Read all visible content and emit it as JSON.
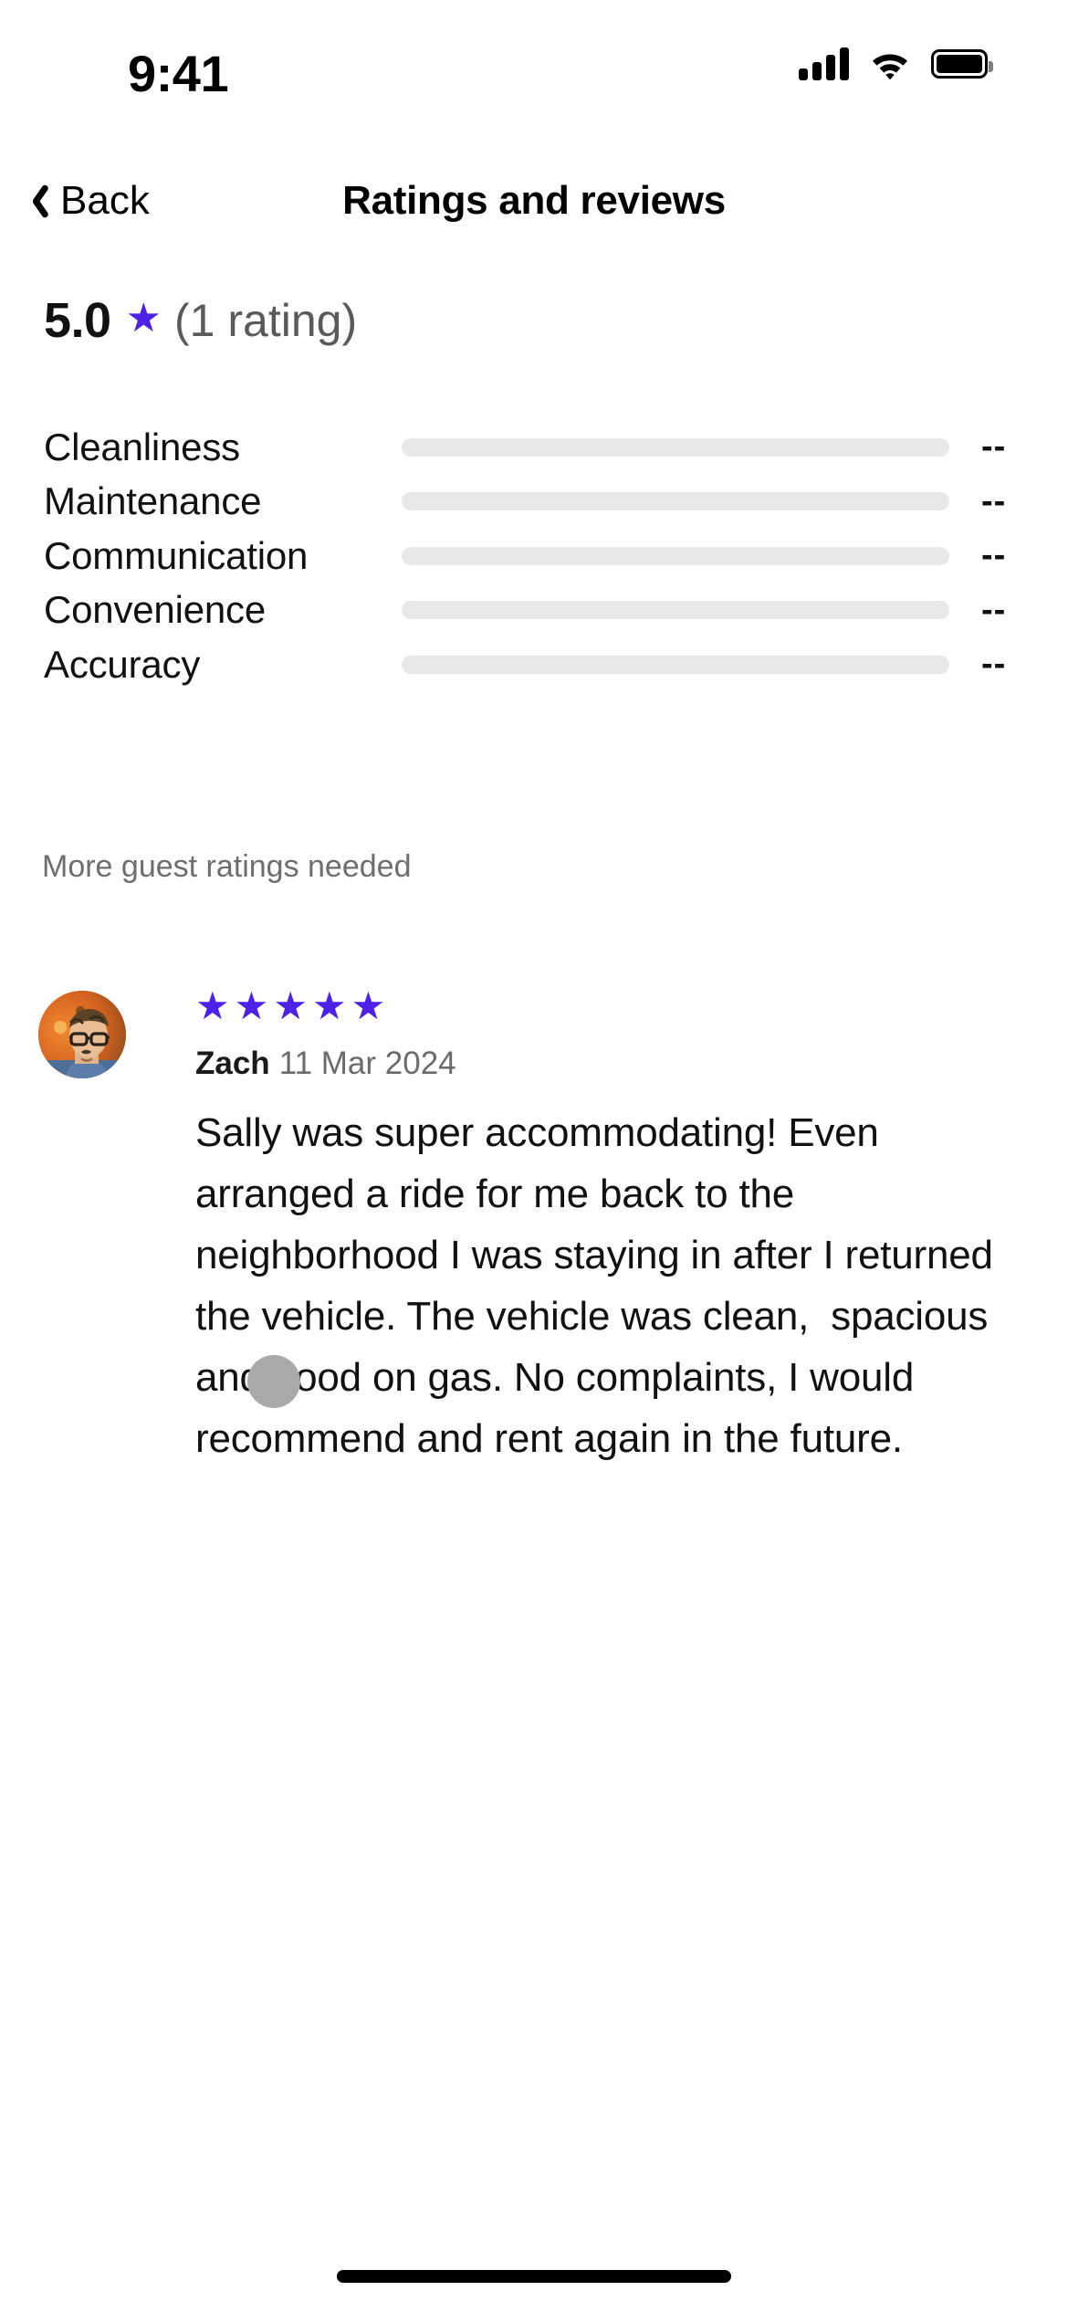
{
  "status_bar": {
    "time": "9:41",
    "cellular_icon": "cellular-signal-icon",
    "wifi_icon": "wifi-icon",
    "battery_icon": "battery-full-icon"
  },
  "nav": {
    "back_label": "Back",
    "back_icon": "chevron-left-icon",
    "title": "Ratings and reviews"
  },
  "overall": {
    "score": "5.0",
    "star_glyph": "★",
    "count_label": "(1 rating)"
  },
  "categories": [
    {
      "label": "Cleanliness",
      "value": "--",
      "bar_percent": 0
    },
    {
      "label": "Maintenance",
      "value": "--",
      "bar_percent": 0
    },
    {
      "label": "Communication",
      "value": "--",
      "bar_percent": 0
    },
    {
      "label": "Convenience",
      "value": "--",
      "bar_percent": 0
    },
    {
      "label": "Accuracy",
      "value": "--",
      "bar_percent": 0
    }
  ],
  "ratings_note": "More guest ratings needed",
  "review": {
    "avatar_icon": "user-avatar-photo",
    "stars": 5,
    "star_glyph": "★",
    "reviewer_name": "Zach",
    "date": "11 Mar 2024",
    "text": "Sally was super accommodating! Even arranged a ride for me back to the neighborhood I was staying in after I returned the vehicle. The vehicle was clean,  spacious and good on gas. No complaints, I would recommend and rent again in the future."
  },
  "colors": {
    "accent_purple": "#4d22e6",
    "bar_track": "#e8e8e8",
    "muted_text": "#6b6b6b",
    "touch_indicator": "#a9a9a9"
  },
  "touch_indicator": {
    "name": "touch-point-indicator"
  },
  "home_indicator": {
    "name": "home-indicator"
  }
}
